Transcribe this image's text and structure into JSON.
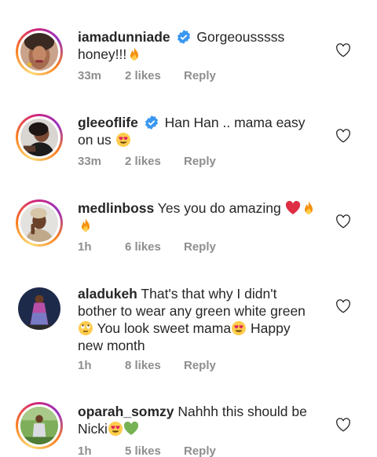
{
  "comments": [
    {
      "username": "iamadunniade",
      "verified": true,
      "text_line1": "Gorgeousssss",
      "text_line2": "honey!!!",
      "emojis_line2": [
        "fire"
      ],
      "time": "33m",
      "likes": "2 likes",
      "reply": "Reply",
      "story_ring": true
    },
    {
      "username": "gleeoflife",
      "verified": true,
      "text_line1": "Han Han .. mama easy",
      "text_line2": "on us",
      "emojis_line2": [
        "heart-eyes"
      ],
      "time": "33m",
      "likes": "2 likes",
      "reply": "Reply",
      "story_ring": true
    },
    {
      "username": "medlinboss",
      "verified": false,
      "text_line1": "Yes you do amazing",
      "emojis_line1": [
        "red-heart",
        "fire"
      ],
      "emojis_line2": [
        "fire"
      ],
      "time": "1h",
      "likes": "6 likes",
      "reply": "Reply",
      "story_ring": true
    },
    {
      "username": "aladukeh",
      "verified": false,
      "text_line1": "That's that why I didn't",
      "text_line2": "bother to wear any green white green",
      "text_line3a": "You look sweet mama",
      "text_line3b": "Happy",
      "text_line4": "new month",
      "emojis_line3": [
        "rolling-eyes",
        "heart-eyes"
      ],
      "time": "1h",
      "likes": "8 likes",
      "reply": "Reply",
      "story_ring": false
    },
    {
      "username": "oparah_somzy",
      "verified": false,
      "text_line1": "Nahhh this should be",
      "text_line2": "Nicki",
      "emojis_line2": [
        "heart-eyes",
        "green-heart"
      ],
      "time": "1h",
      "likes": "5 likes",
      "reply": "Reply",
      "story_ring": true
    }
  ],
  "colors": {
    "text": "#262626",
    "meta": "#8e8e8e",
    "verified": "#3897f0",
    "ring_start": "#feda75",
    "ring_end": "#d62976"
  },
  "icons": {
    "like": "heart-outline-icon",
    "verified": "verified-badge-icon"
  }
}
